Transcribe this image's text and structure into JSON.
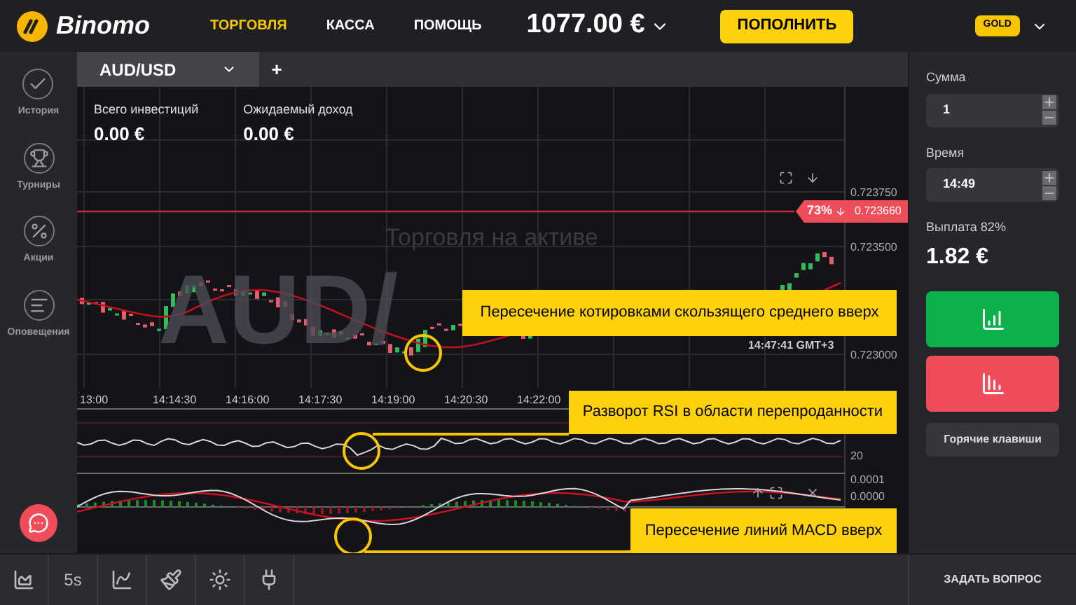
{
  "header": {
    "logo": "Binomo",
    "nav": [
      {
        "label": "ТОРГОВЛЯ",
        "selected": true
      },
      {
        "label": "КАССА",
        "selected": false
      },
      {
        "label": "ПОМОЩЬ",
        "selected": false
      }
    ],
    "balance": "1077.00 €",
    "deposit_button": "ПОПОЛНИТЬ",
    "status_badge": "GOLD"
  },
  "sidebar": {
    "items": [
      {
        "kind": "history",
        "label": "История"
      },
      {
        "kind": "tournaments",
        "label": "Турниры"
      },
      {
        "kind": "promotions",
        "label": "Акции"
      },
      {
        "kind": "notifications",
        "label": "Оповещения"
      }
    ]
  },
  "asset_tab": {
    "label": "AUD/USD",
    "add": "+"
  },
  "stats": [
    {
      "label": "Всего инвестиций",
      "value": "0.00 €"
    },
    {
      "label": "Ожидаемый доход",
      "value": "0.00 €"
    }
  ],
  "chart": {
    "watermark_title": "Торговля на активе",
    "watermark_asset": "AUD/",
    "price_ticks": [
      "0.723750",
      "0.723500",
      "0.723000"
    ],
    "current_price": {
      "percent": "73%",
      "value": "0.723660"
    },
    "cursor_time": "14:47:41 GMT+3",
    "time_ticks": [
      "13:00",
      "14:14:30",
      "14:16:00",
      "14:17:30",
      "14:19:00",
      "14:20:30",
      "14:22:00"
    ],
    "rsi_ticks": [
      "20"
    ],
    "macd_ticks": [
      "0.0001",
      "0.0000"
    ]
  },
  "annotations": [
    {
      "text": "Пересечение котировками скользящего среднего вверх"
    },
    {
      "text": "Разворот RSI в области перепроданности"
    },
    {
      "text": "Пересечение линий MACD вверх"
    }
  ],
  "trade_panel": {
    "amount_label": "Сумма",
    "amount": "1",
    "time_label": "Время",
    "time": "14:49",
    "payout_label": "Выплата 82%",
    "payout": "1.82 €",
    "hotkeys_button": "Горячие клавиши"
  },
  "toolbar": {
    "items": [
      {
        "kind": "chart-type"
      },
      {
        "kind": "timeframe",
        "label": "5s"
      },
      {
        "kind": "indicators"
      },
      {
        "kind": "drawing"
      },
      {
        "kind": "theme"
      },
      {
        "kind": "plugin"
      }
    ]
  },
  "ask_button": "ЗАДАТЬ ВОПРОС"
}
